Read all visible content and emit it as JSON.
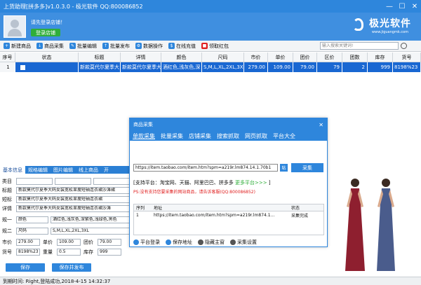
{
  "app": {
    "title": "上货助理[拼多多]v1.0.3.0 - 极光软件 QQ:800086852",
    "win_min": "—",
    "win_max": "☐",
    "win_close": "✕"
  },
  "header": {
    "login_hint": "请先登录店铺！",
    "login_button": "登录店铺",
    "logo_text": "极光软件",
    "logo_url": "www.jiguangmk.com"
  },
  "toolbar": {
    "items": [
      "新建商品",
      "商品采集",
      "批量编辑",
      "批量发布",
      "数据操作",
      "在线充值",
      "领取红包"
    ],
    "search_placeholder": "输入搜索关键词!"
  },
  "table": {
    "headers": [
      "序号",
      "状态",
      "标题",
      "详情",
      "颜色",
      "尺码",
      "市价",
      "单价",
      "团价",
      "区价",
      "团数",
      "库存",
      "货号"
    ],
    "rows": [
      [
        "1",
        "",
        "新款莫代尔夏季大",
        "新款莫代尔夏季大",
        "酒红色,浅灰色,深",
        "S,M,L,XL,2XL,3XL",
        "279.00",
        "109.00",
        "79.00",
        "79",
        "2",
        "999",
        "8198%23"
      ]
    ]
  },
  "bottom_tabs": [
    "基本信息",
    "规格编辑",
    "图片编辑",
    "线上商品",
    "开"
  ],
  "form": {
    "category_label": "类目",
    "short_label": "标题",
    "short_value": "新款莫代尔夏季大码女装宽松显瘦短袖连衣裙沙滩裙",
    "brief_label": "短标",
    "brief_value": "新款莫代尔夏季大码女装宽松显瘦短袖连衣裙",
    "detail_label": "详情",
    "detail_value": "新款莫代尔夏季大码女装宽松显瘦短袖连衣裙沙滩",
    "spec1_label": "规一",
    "spec1_name": "颜色",
    "spec1_value": "酒红色,浅灰色,深紫色,浅绿色,黑色",
    "spec2_label": "规二",
    "spec2_name": "尺码",
    "spec2_value": "S,M,L,XL,2XL,3XL",
    "market_label": "市价",
    "market_value": "279.00",
    "unit_label": "单价",
    "unit_value": "109.00",
    "group_label": "团价",
    "group_value": "79.00",
    "sku_label": "货号",
    "sku_value": "8198%23",
    "weight_label": "重量",
    "weight_value": "0.5",
    "stock_label": "库存",
    "stock_value": "999",
    "save": "保存",
    "save_publish": "保存并发布"
  },
  "status": {
    "text": "到期时间:    Right,登陆成功,2018-4-15 14:32:37"
  },
  "dialog": {
    "title": "商品采集",
    "close": "✕",
    "tabs": [
      "单款采集",
      "批量采集",
      "店铺采集",
      "搜索抓取",
      "网页抓取",
      "平台大全"
    ],
    "url": "https://item.taobao.com/item.htm?spm=a219r.lm874.14.1.70b1",
    "paste": "粘",
    "collect": "采集",
    "support": "[支持平台：淘宝网、天猫、阿里巴巴、拼多多",
    "more": "更多平台>>>",
    "support_end": "]",
    "warn": "PS:没有支持您要采集的网站商品，请告诉客服(QQ:800086852)",
    "list_headers": [
      "序列",
      "地址",
      "状态"
    ],
    "list_row": [
      "1",
      "https://item.taobao.com/item.htm?spm=a219r.lm874.1...",
      "采集完成"
    ],
    "footer": [
      "平台登录",
      "保存地址",
      "隐藏主窗",
      "采集设置"
    ]
  },
  "colors": {
    "accent": "#2e86dc",
    "selected_row": "#1967d2",
    "success": "#2fae3a",
    "warn": "#e02020"
  }
}
